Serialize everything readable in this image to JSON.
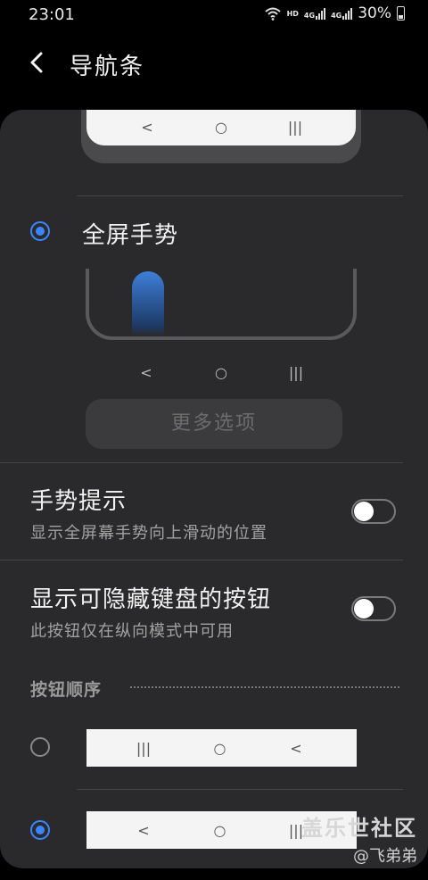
{
  "status": {
    "time": "23:01",
    "hd": "HD",
    "net1": "4G",
    "net2": "4G",
    "battery": "30%"
  },
  "header": {
    "title": "导航条"
  },
  "nav_glyphs": {
    "back": "<",
    "home": "○",
    "recent": "|||"
  },
  "options": {
    "fullscreen_gestures": {
      "label": "全屏手势",
      "selected": true
    },
    "more_options": "更多选项"
  },
  "settings": {
    "gesture_hint": {
      "title": "手势提示",
      "subtitle": "显示全屏幕手势向上滑动的位置",
      "enabled": false
    },
    "keyboard_button": {
      "title": "显示可隐藏键盘的按钮",
      "subtitle": "此按钮仅在纵向模式中可用",
      "enabled": false
    }
  },
  "button_order": {
    "heading": "按钮顺序",
    "choices": [
      {
        "order": [
          "recent",
          "home",
          "back"
        ],
        "selected": false
      },
      {
        "order": [
          "back",
          "home",
          "recent"
        ],
        "selected": true
      }
    ]
  },
  "watermark": {
    "brand": "盖乐世社区",
    "user": "@飞弟弟"
  },
  "colors": {
    "accent": "#3b86ff",
    "card": "#2a2a2c",
    "background": "#000000"
  }
}
